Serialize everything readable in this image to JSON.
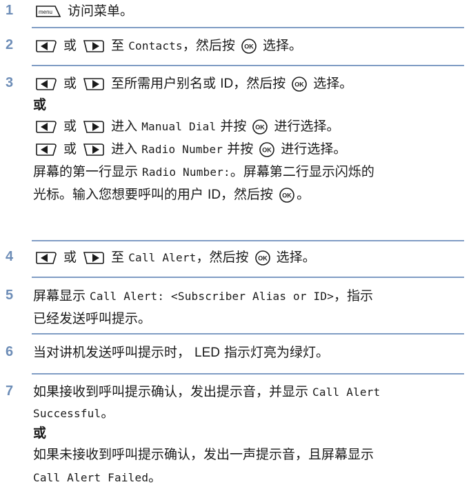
{
  "steps": [
    {
      "num": "1",
      "lines": [
        {
          "parts": [
            {
              "icon": "menu"
            },
            {
              "t": " 访问菜单。"
            }
          ]
        }
      ]
    },
    {
      "num": "2",
      "lines": [
        {
          "parts": [
            {
              "icon": "left"
            },
            {
              "t": " 或 "
            },
            {
              "icon": "right"
            },
            {
              "t": " 至 "
            },
            {
              "m": "Contacts"
            },
            {
              "t": "，然后按 "
            },
            {
              "icon": "ok"
            },
            {
              "t": " 选择。"
            }
          ]
        }
      ]
    },
    {
      "num": "3",
      "lines": [
        {
          "parts": [
            {
              "icon": "left"
            },
            {
              "t": " 或 "
            },
            {
              "icon": "right"
            },
            {
              "t": " 至所需用户别名或 "
            },
            {
              "s": "ID"
            },
            {
              "t": "，然后按 "
            },
            {
              "icon": "ok"
            },
            {
              "t": " 选择。"
            }
          ]
        },
        {
          "short": true,
          "parts": [
            {
              "b": "或"
            }
          ]
        },
        {
          "parts": [
            {
              "icon": "left"
            },
            {
              "t": " 或 "
            },
            {
              "icon": "right"
            },
            {
              "t": " 进入 "
            },
            {
              "m": "Manual Dial"
            },
            {
              "t": " 并按 "
            },
            {
              "icon": "ok"
            },
            {
              "t": " 进行选择。"
            }
          ]
        },
        {
          "parts": [
            {
              "icon": "left"
            },
            {
              "t": " 或 "
            },
            {
              "icon": "right"
            },
            {
              "t": " 进入 "
            },
            {
              "m": "Radio Number"
            },
            {
              "t": " 并按 "
            },
            {
              "icon": "ok"
            },
            {
              "t": " 进行选择。"
            }
          ]
        },
        {
          "parts": [
            {
              "t": "屏幕的第一行显示 "
            },
            {
              "m": "Radio Number:"
            },
            {
              "t": "。屏幕第二行显示闪烁的"
            }
          ]
        },
        {
          "parts": [
            {
              "t": "光标。输入您想要呼叫的用户 "
            },
            {
              "s": "ID"
            },
            {
              "t": "，然后按 "
            },
            {
              "icon": "ok"
            },
            {
              "t": "。"
            }
          ]
        }
      ]
    },
    {
      "num": "4",
      "lines": [
        {
          "parts": [
            {
              "icon": "left"
            },
            {
              "t": " 或 "
            },
            {
              "icon": "right"
            },
            {
              "t": " 至 "
            },
            {
              "m": "Call Alert"
            },
            {
              "t": "，然后按 "
            },
            {
              "icon": "ok"
            },
            {
              "t": " 选择。"
            }
          ]
        }
      ]
    },
    {
      "num": "5",
      "lines": [
        {
          "parts": [
            {
              "t": "屏幕显示 "
            },
            {
              "m": "Call Alert: <Subscriber Alias or ID>"
            },
            {
              "t": "，指示"
            }
          ]
        },
        {
          "parts": [
            {
              "t": "已经发送呼叫提示。"
            }
          ]
        }
      ]
    },
    {
      "num": "6",
      "lines": [
        {
          "parts": [
            {
              "t": "当对讲机发送呼叫提示时， "
            },
            {
              "s": "LED"
            },
            {
              "t": " 指示灯亮为绿灯。"
            }
          ]
        }
      ]
    },
    {
      "num": "7",
      "lines": [
        {
          "parts": [
            {
              "t": "如果接收到呼叫提示确认，发出提示音，并显示 "
            },
            {
              "m": "Call Alert"
            }
          ]
        },
        {
          "short": true,
          "parts": [
            {
              "m": "Successful"
            },
            {
              "t": "。"
            }
          ]
        },
        {
          "short": true,
          "parts": [
            {
              "b": "或"
            }
          ]
        },
        {
          "parts": [
            {
              "t": "如果未接收到呼叫提示确认，发出一声提示音，且屏幕显示"
            }
          ]
        },
        {
          "parts": [
            {
              "m": "Call Alert Failed"
            },
            {
              "t": "。"
            }
          ]
        }
      ]
    }
  ],
  "icons": {
    "menu": "menu",
    "ok": "OK"
  },
  "colors": {
    "accent": "#6d8db7",
    "divider": "#7f9cc4",
    "text": "#1a1a1a"
  }
}
